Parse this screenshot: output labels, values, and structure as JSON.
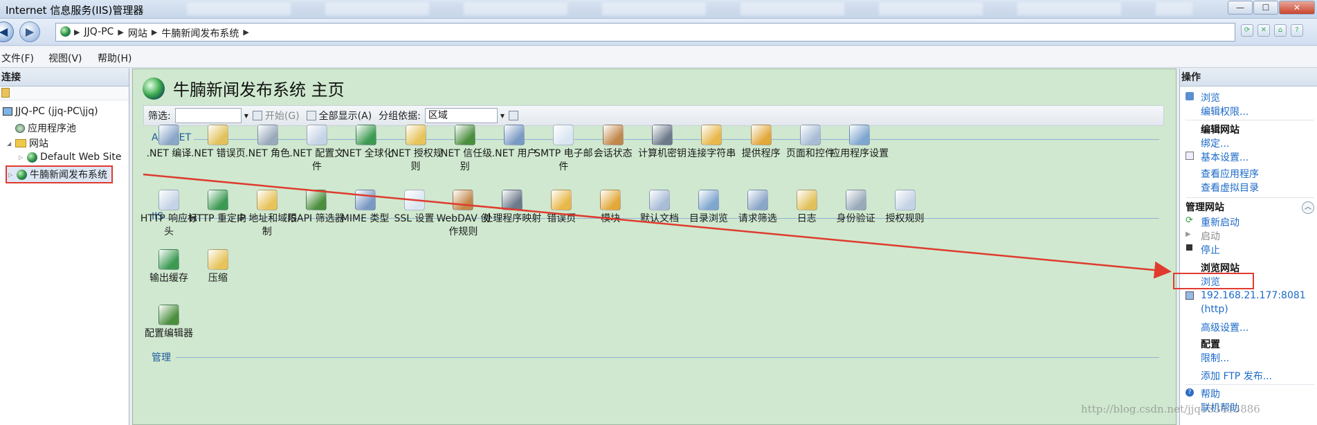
{
  "window": {
    "title": "Internet 信息服务(IIS)管理器",
    "buttons": {
      "minimize": "—",
      "maximize": "☐",
      "close": "✕"
    }
  },
  "address": {
    "crumbs": [
      "JJQ-PC",
      "网站",
      "牛腩新闻发布系统"
    ],
    "separator": "▶",
    "nav_back": "◀",
    "nav_forward": "▶"
  },
  "menu": [
    "文件(F)",
    "视图(V)",
    "帮助(H)"
  ],
  "connections": {
    "header": "连接",
    "tree": [
      {
        "label": "JJQ-PC (jjq-PC\\jjq)",
        "icon": "computer-icon"
      },
      {
        "label": "应用程序池",
        "icon": "app-pool-icon"
      },
      {
        "label": "网站",
        "icon": "folder-icon"
      },
      {
        "label": "Default Web Site",
        "icon": "globe-icon"
      },
      {
        "label": "牛腩新闻发布系统",
        "icon": "globe-icon",
        "selected": true
      }
    ]
  },
  "main": {
    "title": "牛腩新闻发布系统 主页",
    "filter_label": "筛选:",
    "start_label": "开始(G)",
    "show_all_label": "全部显示(A)",
    "group_by_label": "分组依据:",
    "group_by_value": "区域",
    "sections": [
      {
        "title": "ASP.NET",
        "items": [
          ".NET 编译",
          ".NET 错误页",
          ".NET 角色",
          ".NET 配置文件",
          ".NET 全球化",
          ".NET 授权规则",
          ".NET 信任级别",
          ".NET 用户",
          "SMTP 电子邮件",
          "会话状态",
          "计算机密钥",
          "连接字符串",
          "提供程序",
          "页面和控件",
          "应用程序设置"
        ]
      },
      {
        "title": "IIS",
        "items": [
          "HTTP 响应标头",
          "HTTP 重定向",
          "IP 地址和域限制",
          "ISAPI 筛选器",
          "MIME 类型",
          "SSL 设置",
          "WebDAV 创作规则",
          "处理程序映射",
          "错误页",
          "模块",
          "默认文档",
          "目录浏览",
          "请求筛选",
          "日志",
          "身份验证",
          "授权规则",
          "输出缓存",
          "压缩"
        ]
      },
      {
        "title": "管理",
        "items": [
          "配置编辑器"
        ]
      }
    ]
  },
  "actions": {
    "header": "操作",
    "browse": "浏览",
    "edit_permissions": "编辑权限...",
    "edit_site": "编辑网站",
    "bindings": "绑定...",
    "basic_settings": "基本设置...",
    "view_apps": "查看应用程序",
    "view_vdirs": "查看虚拟目录",
    "manage_site": "管理网站",
    "restart": "重新启动",
    "start": "启动",
    "stop": "停止",
    "browse_site": "浏览网站",
    "browse_link": "浏览",
    "binding_url": "192.168.21.177:8081",
    "binding_proto": "(http)",
    "advanced": "高级设置...",
    "config": "配置",
    "limits": "限制...",
    "add_ftp": "添加 FTP 发布...",
    "help": "帮助",
    "online_help": "联机帮助"
  },
  "watermark": "http://blog.csdn.net/jjq533415886",
  "colors": {
    "main_bg": "#cfe8cf",
    "link": "#1b6ac8",
    "annotation": "#e03a2e",
    "section": "#205aa0"
  }
}
